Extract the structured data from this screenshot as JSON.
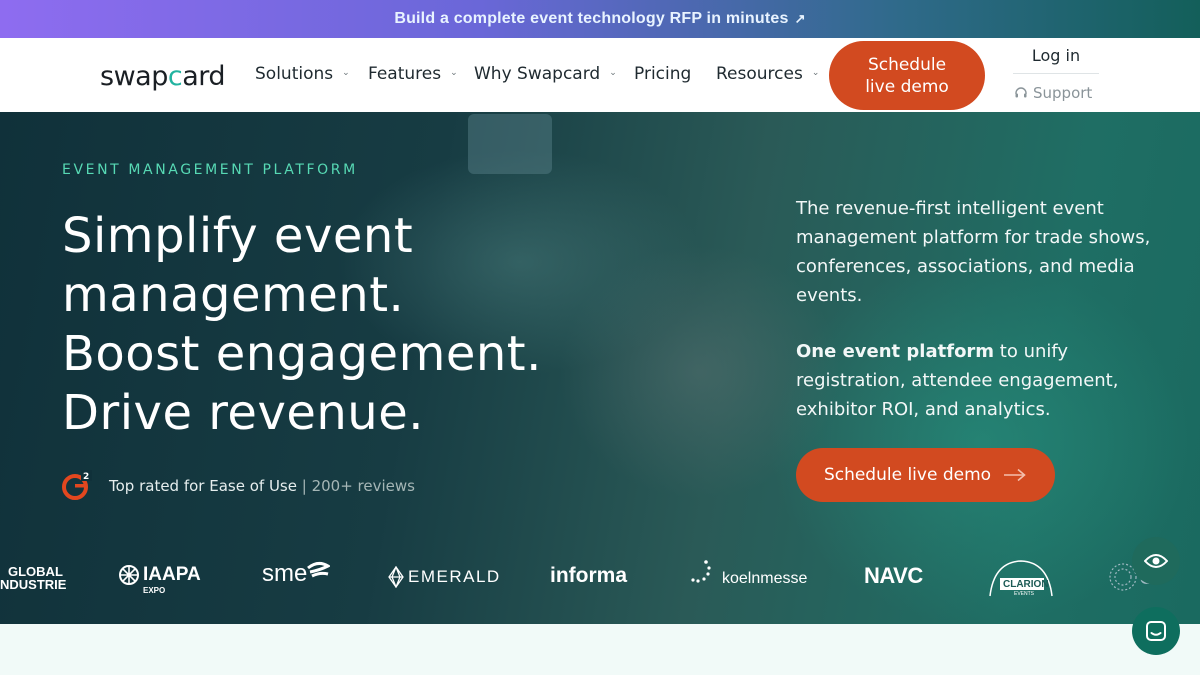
{
  "banner": {
    "text": "Build a complete event technology RFP in minutes",
    "arrow": "↗"
  },
  "nav": {
    "logo": {
      "prefix": "swap",
      "accent": "c",
      "suffix": "ard"
    },
    "items": [
      {
        "label": "Solutions",
        "has_dropdown": true
      },
      {
        "label": "Features",
        "has_dropdown": true
      },
      {
        "label": "Why Swapcard",
        "has_dropdown": true
      },
      {
        "label": "Pricing",
        "has_dropdown": false
      },
      {
        "label": "Resources",
        "has_dropdown": true
      }
    ],
    "cta": {
      "line1": "Schedule",
      "line2": "live demo"
    },
    "login": "Log in",
    "support": "Support"
  },
  "hero": {
    "eyebrow": "EVENT MANAGEMENT PLATFORM",
    "headline": [
      "Simplify event",
      "management.",
      "Boost engagement.",
      "Drive revenue."
    ],
    "rating": {
      "text": "Top rated for Ease of Use",
      "sep": " | ",
      "reviews": "200+ reviews"
    },
    "description": "The revenue-first intelligent event management platform for trade shows, conferences, associations, and media events.",
    "description2": {
      "bold": "One event platform",
      "rest": " to unify registration, attendee engagement, exhibitor ROI, and analytics."
    },
    "cta": "Schedule live demo"
  },
  "logos": {
    "global": {
      "line1": "GLOBAL",
      "line2": "NDUSTRIE"
    },
    "iaapa": {
      "name": "IAAPA",
      "sub": "EXPO"
    },
    "sme": "sme",
    "emerald": "EMERALD",
    "informa": "informa",
    "koelnmesse": "koelnmesse",
    "navc": {
      "name": "NAVC"
    },
    "clarion": {
      "name": "CLARION",
      "sub": "EVENTS"
    },
    "last": "S"
  },
  "colors": {
    "accent": "#d24a20",
    "brand_teal": "#22b3a0",
    "eyebrow": "#57d9b4",
    "fab": "#1f6a5c"
  },
  "icons": {
    "banner_arrow": "external-arrow-icon",
    "support": "headset-icon",
    "hero_cta": "arrow-right-icon",
    "fab_eye": "eye-icon",
    "fab_chat": "chat-icon"
  }
}
